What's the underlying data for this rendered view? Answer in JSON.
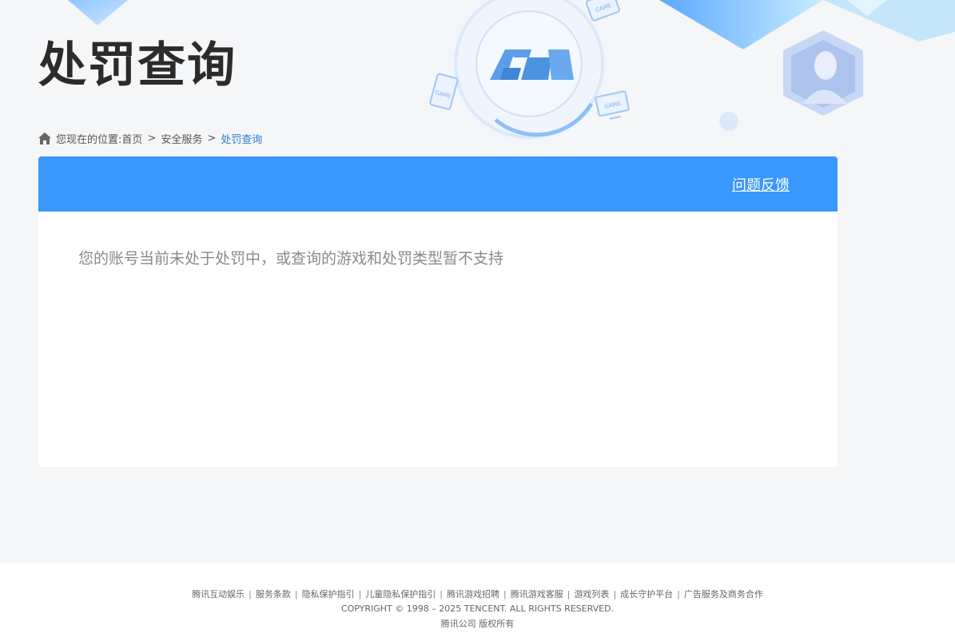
{
  "hero": {
    "logo_text": "ACE",
    "game_badge": "GAME"
  },
  "page_title": "处罚查询",
  "breadcrumb": {
    "prefix": "您现在的位置:",
    "items": [
      {
        "label": "首页"
      },
      {
        "label": "安全服务"
      },
      {
        "label": "处罚查询"
      }
    ],
    "separator": ">"
  },
  "panel": {
    "feedback_label": "问题反馈",
    "message": "您的账号当前未处于处罚中，或查询的游戏和处罚类型暂不支持"
  },
  "footer": {
    "links": [
      {
        "label": "腾讯互动娱乐"
      },
      {
        "label": "服务条款"
      },
      {
        "label": "隐私保护指引"
      },
      {
        "label": "儿童隐私保护指引"
      },
      {
        "label": "腾讯游戏招聘"
      },
      {
        "label": "腾讯游戏客服"
      },
      {
        "label": "游戏列表"
      },
      {
        "label": "成长守护平台"
      },
      {
        "label": "广告服务及商务合作"
      }
    ],
    "link_divider": "|",
    "copyright": "COPYRIGHT © 1998 – 2025 TENCENT. ALL RIGHTS RESERVED.",
    "company": "腾讯公司 版权所有"
  },
  "colors": {
    "accent": "#3a97fb",
    "breadcrumb_current": "#2a7fd0",
    "background": "#f5f6f8"
  }
}
